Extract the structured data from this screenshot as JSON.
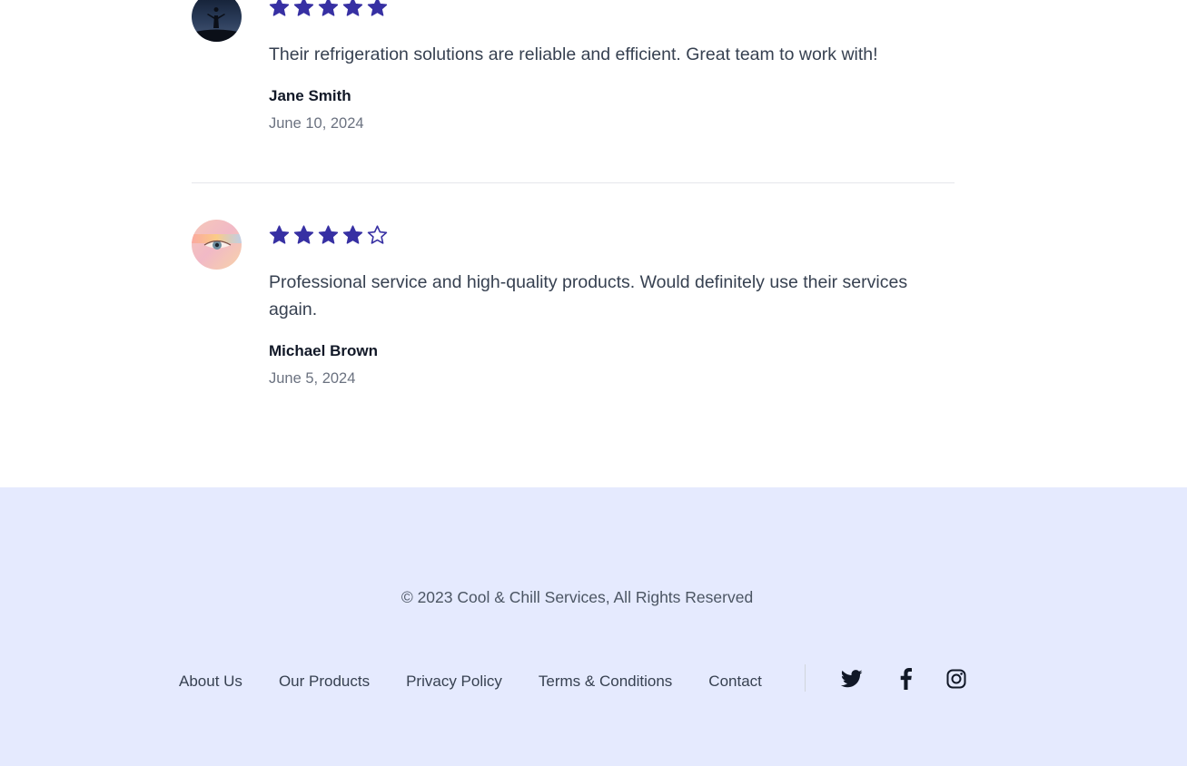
{
  "reviews": [
    {
      "rating": 5,
      "max_rating": 5,
      "text": "Their refrigeration solutions are reliable and efficient. Great team to work with!",
      "name": "Jane Smith",
      "date": "June 10, 2024",
      "avatar_icon": "person-silhouette-avatar"
    },
    {
      "rating": 4,
      "max_rating": 5,
      "text": "Professional service and high-quality products. Would definitely use their services again.",
      "name": "Michael Brown",
      "date": "June 5, 2024",
      "avatar_icon": "eye-closeup-avatar"
    }
  ],
  "footer": {
    "copyright": "© 2023 Cool & Chill Services, All Rights Reserved",
    "links": [
      "About Us",
      "Our Products",
      "Privacy Policy",
      "Terms & Conditions",
      "Contact"
    ],
    "social": [
      "twitter-icon",
      "facebook-icon",
      "instagram-icon"
    ]
  },
  "colors": {
    "star": "#3730a3",
    "footer_bg": "#e5eafe",
    "divider": "#e5e7eb"
  }
}
